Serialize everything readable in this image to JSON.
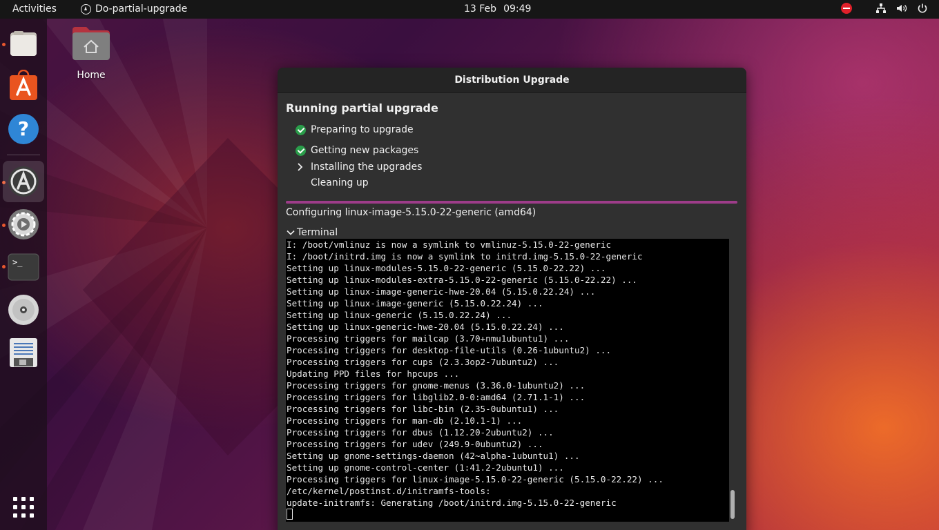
{
  "topbar": {
    "activities": "Activities",
    "app_name": "Do-partial-upgrade",
    "date": "13 Feb",
    "time": "09:49"
  },
  "desktop": {
    "home_label": "Home"
  },
  "dock": {
    "items": [
      "files",
      "app-center",
      "help",
      "software-updater",
      "settings",
      "terminal",
      "disc",
      "text-editor",
      "show-apps"
    ]
  },
  "dialog": {
    "title": "Distribution Upgrade",
    "heading": "Running partial upgrade",
    "steps": [
      {
        "label": "Preparing to upgrade",
        "state": "done"
      },
      {
        "label": "Getting new packages",
        "state": "done"
      },
      {
        "label": "Installing the upgrades",
        "state": "current"
      },
      {
        "label": "Cleaning up",
        "state": "pending"
      }
    ],
    "progress": 1.0,
    "status": "Configuring linux-image-5.15.0-22-generic (amd64)",
    "terminal_label": "Terminal",
    "terminal_lines": [
      "I: /boot/vmlinuz is now a symlink to vmlinuz-5.15.0-22-generic",
      "I: /boot/initrd.img is now a symlink to initrd.img-5.15.0-22-generic",
      "Setting up linux-modules-5.15.0-22-generic (5.15.0-22.22) ...",
      "Setting up linux-modules-extra-5.15.0-22-generic (5.15.0-22.22) ...",
      "Setting up linux-image-generic-hwe-20.04 (5.15.0.22.24) ...",
      "Setting up linux-image-generic (5.15.0.22.24) ...",
      "Setting up linux-generic (5.15.0.22.24) ...",
      "Setting up linux-generic-hwe-20.04 (5.15.0.22.24) ...",
      "Processing triggers for mailcap (3.70+nmu1ubuntu1) ...",
      "Processing triggers for desktop-file-utils (0.26-1ubuntu2) ...",
      "Processing triggers for cups (2.3.3op2-7ubuntu2) ...",
      "Updating PPD files for hpcups ...",
      "Processing triggers for gnome-menus (3.36.0-1ubuntu2) ...",
      "Processing triggers for libglib2.0-0:amd64 (2.71.1-1) ...",
      "Processing triggers for libc-bin (2.35-0ubuntu1) ...",
      "Processing triggers for man-db (2.10.1-1) ...",
      "Processing triggers for dbus (1.12.20-2ubuntu2) ...",
      "Processing triggers for udev (249.9-0ubuntu2) ...",
      "Setting up gnome-settings-daemon (42~alpha-1ubuntu1) ...",
      "Setting up gnome-control-center (1:41.2-2ubuntu1) ...",
      "Processing triggers for linux-image-5.15.0-22-generic (5.15.0-22.22) ...",
      "/etc/kernel/postinst.d/initramfs-tools:",
      "update-initramfs: Generating /boot/initrd.img-5.15.0-22-generic"
    ]
  },
  "colors": {
    "accent": "#9d3c89",
    "check": "#2a9d4a",
    "dnd": "#e0202a",
    "dock_dot": "#e8572e"
  }
}
